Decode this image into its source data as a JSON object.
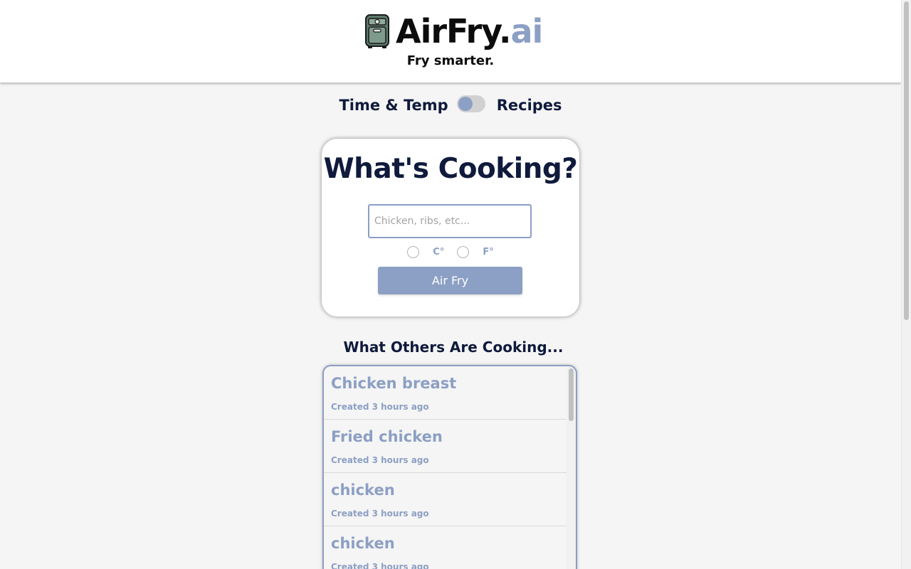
{
  "header": {
    "brand_main": "AirFry.",
    "brand_accent": "ai",
    "tagline": "Fry smarter.",
    "logo_icon": "air-fryer-icon"
  },
  "mode_toggle": {
    "left_label": "Time & Temp",
    "right_label": "Recipes",
    "state": "off"
  },
  "card": {
    "title": "What's Cooking?",
    "search_placeholder": "Chicken, ribs, etc...",
    "search_value": "",
    "units": [
      {
        "label": "C°",
        "selected": false
      },
      {
        "label": "F°",
        "selected": false
      }
    ],
    "submit_label": "Air Fry"
  },
  "others": {
    "title": "What Others Are Cooking...",
    "items": [
      {
        "name": "Chicken breast",
        "created": "Created 3 hours ago"
      },
      {
        "name": "Fried chicken",
        "created": "Created 3 hours ago"
      },
      {
        "name": "chicken",
        "created": "Created 3 hours ago"
      },
      {
        "name": "chicken",
        "created": "Created 3 hours ago"
      }
    ]
  },
  "colors": {
    "accent": "#8c9fc4",
    "navy": "#0f1a3c",
    "background": "#f5f5f5",
    "fryer_body": "#5e7a6c"
  }
}
